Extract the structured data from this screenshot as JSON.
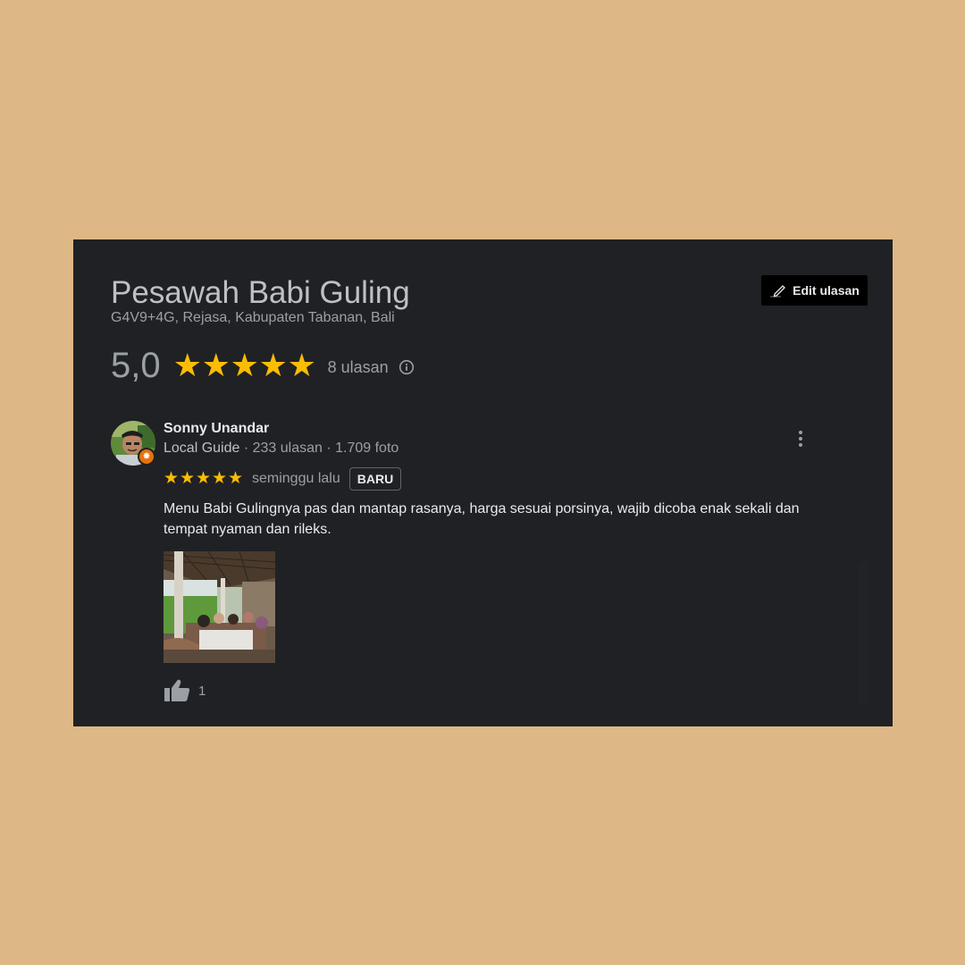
{
  "place": {
    "name": "Pesawah Babi Guling",
    "address": "G4V9+4G, Rejasa, Kabupaten Tabanan, Bali",
    "rating": "5,0",
    "stars": 5,
    "review_count_label": "8 ulasan"
  },
  "actions": {
    "edit_review_label": "Edit ulasan"
  },
  "review": {
    "author": "Sonny Unandar",
    "author_badge": "Local Guide",
    "author_stats": " · 233 ulasan · 1.709 foto",
    "stars": 5,
    "time": "seminggu lalu",
    "new_badge": "BARU",
    "text": "Menu Babi Gulingnya pas dan mantap rasanya, harga sesuai porsinya, wajib dicoba enak sekali dan tempat nyaman dan rileks.",
    "likes": "1"
  },
  "colors": {
    "background": "#ddb886",
    "panel": "#202124",
    "star": "#fbbc04",
    "local_guide_badge": "#e8710a"
  },
  "icons": {
    "edit": "pencil-icon",
    "info": "info-icon",
    "more": "more-vert-icon",
    "like": "thumb-up-icon",
    "local_guide": "local-guide-star-icon"
  }
}
